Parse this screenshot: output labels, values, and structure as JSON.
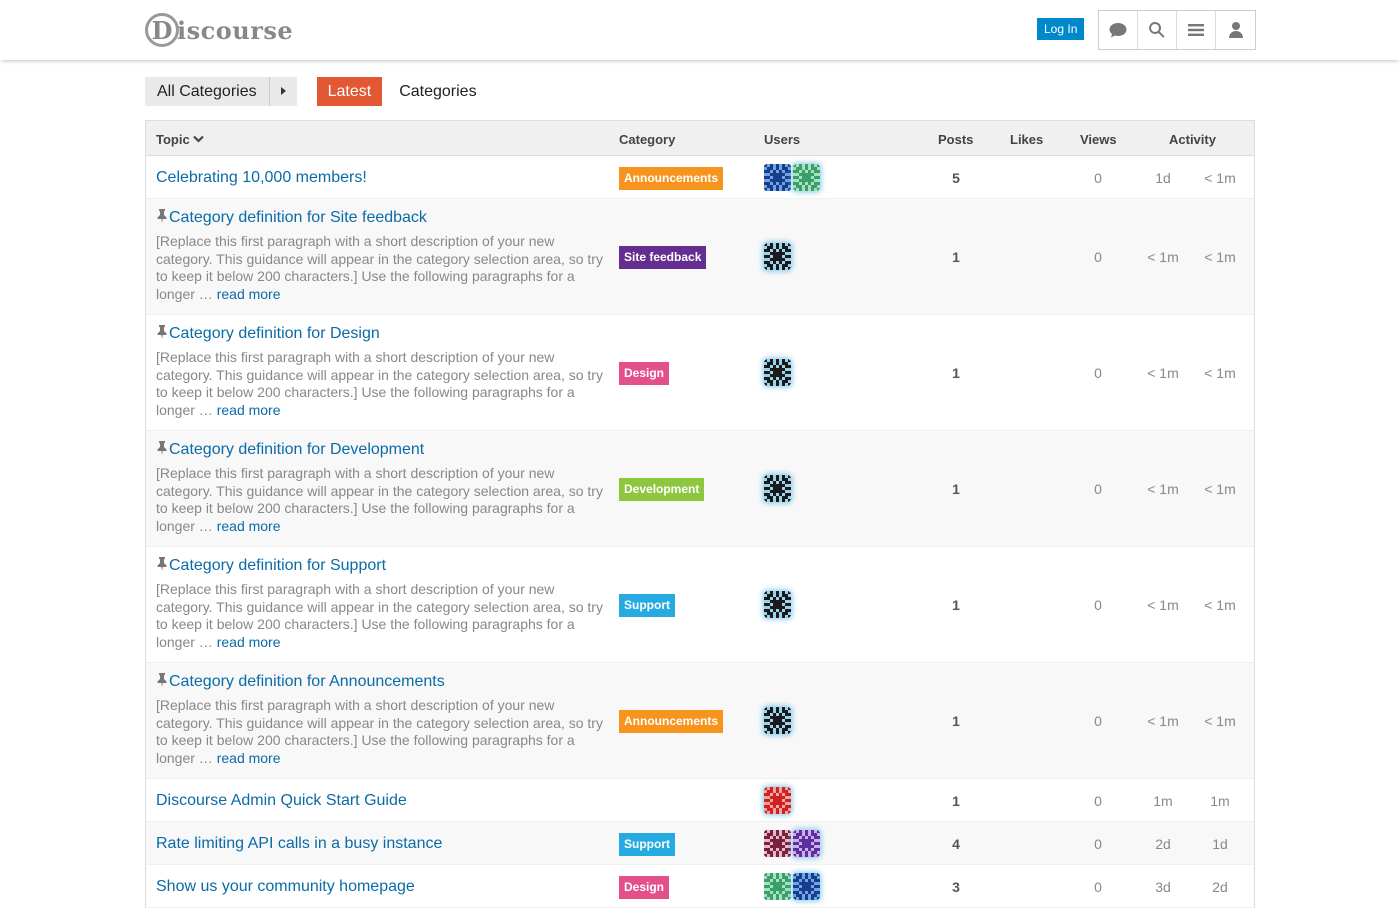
{
  "header": {
    "logo_text": "iscourse",
    "logo_mark": "D",
    "login_label": "Log In",
    "icons": [
      "chat-icon",
      "search-icon",
      "hamburger-icon",
      "user-icon"
    ]
  },
  "nav": {
    "category_dropdown": "All Categories",
    "tabs": [
      {
        "label": "Latest",
        "active": true
      },
      {
        "label": "Categories",
        "active": false
      }
    ]
  },
  "table": {
    "headers": {
      "topic": "Topic",
      "category": "Category",
      "users": "Users",
      "posts": "Posts",
      "likes": "Likes",
      "views": "Views",
      "activity": "Activity"
    },
    "excerpt_text": "[Replace this first paragraph with a short description of your new category. This guidance will appear in the category selection area, so try to keep it below 200 characters.] Use the following paragraphs for a longer …",
    "read_more": "read more",
    "rows": [
      {
        "title": "Celebrating 10,000 members!",
        "pinned": false,
        "category": "Announcements",
        "cat_color": "#f7941d",
        "avatars": 2,
        "posts": "5",
        "views": "0",
        "created": "1d",
        "last": "< 1m"
      },
      {
        "title": "Category definition for Site feedback",
        "pinned": true,
        "category": "Site feedback",
        "cat_color": "#652d90",
        "avatars": 1,
        "posts": "1",
        "views": "0",
        "created": "< 1m",
        "last": "< 1m"
      },
      {
        "title": "Category definition for Design",
        "pinned": true,
        "category": "Design",
        "cat_color": "#e4518a",
        "avatars": 1,
        "posts": "1",
        "views": "0",
        "created": "< 1m",
        "last": "< 1m"
      },
      {
        "title": "Category definition for Development",
        "pinned": true,
        "category": "Development",
        "cat_color": "#8dc63f",
        "avatars": 1,
        "posts": "1",
        "views": "0",
        "created": "< 1m",
        "last": "< 1m"
      },
      {
        "title": "Category definition for Support",
        "pinned": true,
        "category": "Support",
        "cat_color": "#25aae2",
        "avatars": 1,
        "posts": "1",
        "views": "0",
        "created": "< 1m",
        "last": "< 1m"
      },
      {
        "title": "Category definition for Announcements",
        "pinned": true,
        "category": "Announcements",
        "cat_color": "#f7941d",
        "avatars": 1,
        "posts": "1",
        "views": "0",
        "created": "< 1m",
        "last": "< 1m"
      },
      {
        "title": "Discourse Admin Quick Start Guide",
        "pinned": false,
        "category": "",
        "cat_color": "",
        "avatars": 1,
        "posts": "1",
        "views": "0",
        "created": "1m",
        "last": "1m"
      },
      {
        "title": "Rate limiting API calls in a busy instance",
        "pinned": false,
        "category": "Support",
        "cat_color": "#25aae2",
        "avatars": 2,
        "posts": "4",
        "views": "0",
        "created": "2d",
        "last": "1d"
      },
      {
        "title": "Show us your community homepage",
        "pinned": false,
        "category": "Design",
        "cat_color": "#e4518a",
        "avatars": 2,
        "posts": "3",
        "views": "0",
        "created": "3d",
        "last": "2d"
      }
    ]
  }
}
